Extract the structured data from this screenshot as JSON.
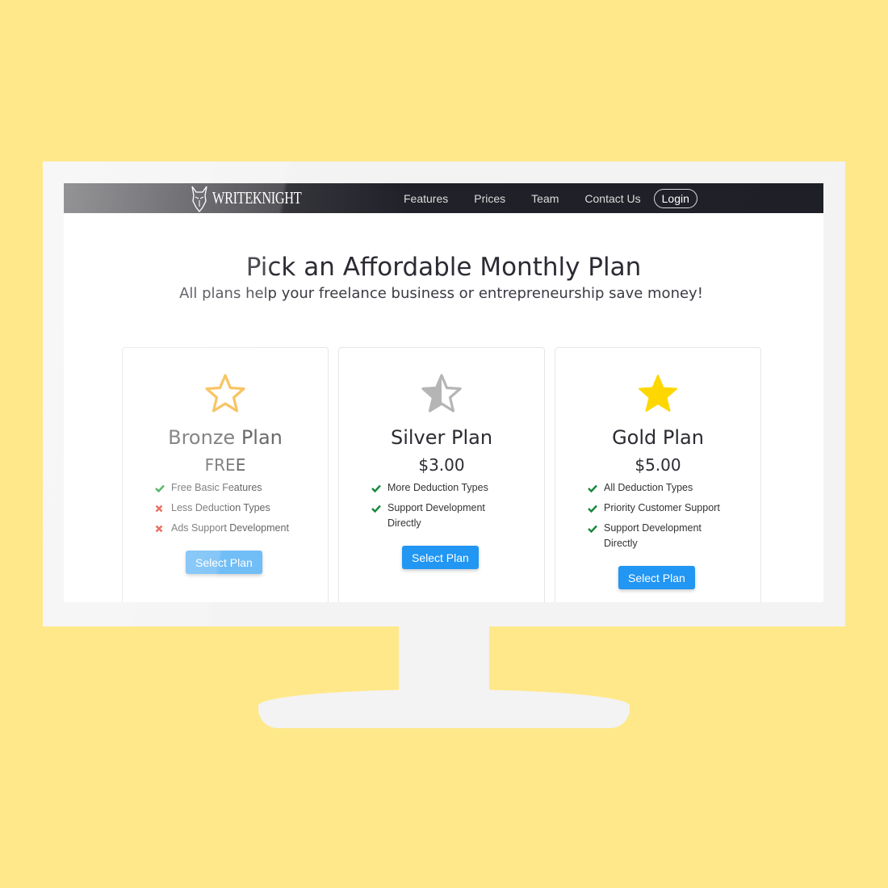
{
  "brand": {
    "name": "WRITEKNIGHT"
  },
  "nav": {
    "links": [
      "Features",
      "Prices",
      "Team",
      "Contact Us"
    ],
    "login_label": "Login"
  },
  "hero": {
    "title": "Pick an Affordable Monthly Plan",
    "subtitle": "All plans help your freelance business or entrepreneurship save money!"
  },
  "plans": [
    {
      "name": "Bronze Plan",
      "price": "FREE",
      "icon": "star-outline-icon",
      "icon_color": "#f7b944",
      "features": [
        {
          "text": "Free Basic Features",
          "included": true
        },
        {
          "text": "Less Deduction Types",
          "included": false
        },
        {
          "text": "Ads Support Development",
          "included": false
        }
      ],
      "button_label": "Select Plan"
    },
    {
      "name": "Silver Plan",
      "price": "$3.00",
      "icon": "star-half-icon",
      "icon_color": "#b5b5b5",
      "features": [
        {
          "text": "More Deduction Types",
          "included": true
        },
        {
          "text": "Support Development Directly",
          "included": true
        }
      ],
      "button_label": "Select Plan"
    },
    {
      "name": "Gold Plan",
      "price": "$5.00",
      "icon": "star-filled-icon",
      "icon_color": "#fed700",
      "features": [
        {
          "text": "All Deduction Types",
          "included": true
        },
        {
          "text": "Priority Customer Support",
          "included": true
        },
        {
          "text": "Support Development Directly",
          "included": true
        }
      ],
      "button_label": "Select Plan"
    }
  ],
  "colors": {
    "background": "#ffe88a",
    "accent": "#2196f3",
    "check": "#28a745",
    "cross": "#e74c3c"
  }
}
